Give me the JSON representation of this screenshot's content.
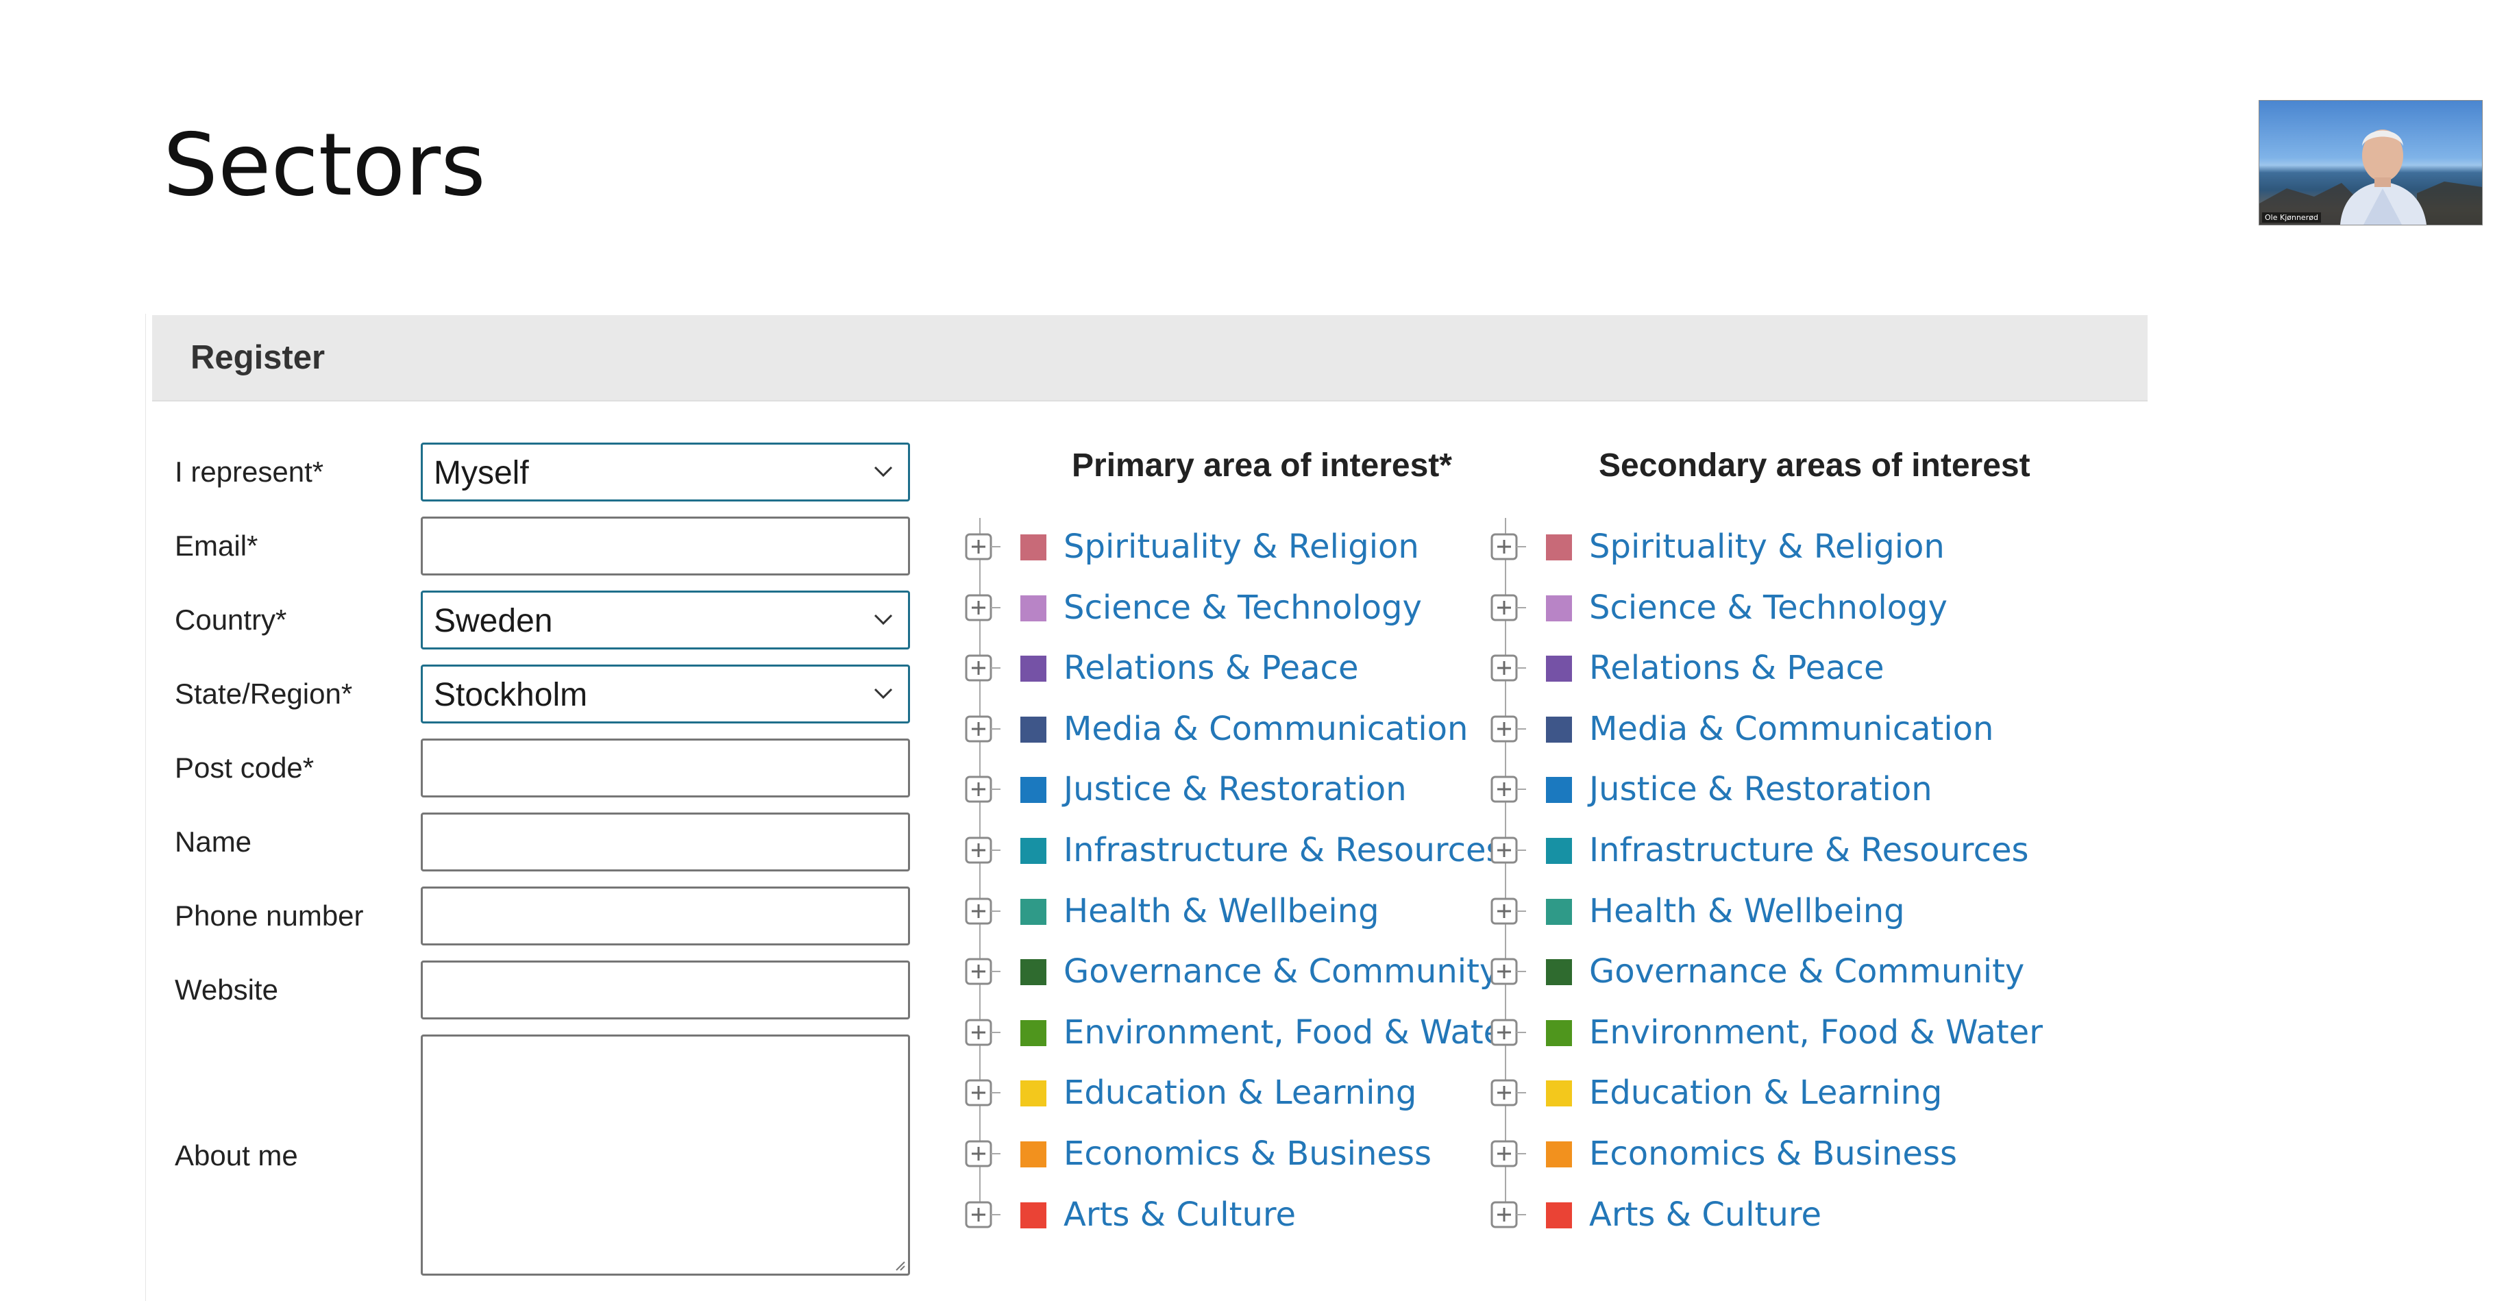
{
  "slide": {
    "title": "Sectors"
  },
  "webcam": {
    "name": "Ole Kjønnerød"
  },
  "form": {
    "header": "Register",
    "fields": [
      {
        "label": "I represent*",
        "type": "select",
        "value": "Myself"
      },
      {
        "label": "Email*",
        "type": "text",
        "value": ""
      },
      {
        "label": "Country*",
        "type": "select",
        "value": "Sweden"
      },
      {
        "label": "State/Region*",
        "type": "select",
        "value": "Stockholm"
      },
      {
        "label": "Post code*",
        "type": "text",
        "value": ""
      },
      {
        "label": "Name",
        "type": "text",
        "value": ""
      },
      {
        "label": "Phone number",
        "type": "text",
        "value": ""
      },
      {
        "label": "Website",
        "type": "text",
        "value": ""
      },
      {
        "label": "About me",
        "type": "textarea",
        "value": ""
      }
    ]
  },
  "primary": {
    "heading": "Primary area of interest*"
  },
  "secondary": {
    "heading": "Secondary areas of interest"
  },
  "sectors": [
    {
      "label": "Spirituality & Religion",
      "color": "#c86a78"
    },
    {
      "label": "Science & Technology",
      "color": "#b884c6"
    },
    {
      "label": "Relations & Peace",
      "color": "#7552a6"
    },
    {
      "label": "Media & Communication",
      "color": "#3e5689"
    },
    {
      "label": "Justice & Restoration",
      "color": "#1b79bf"
    },
    {
      "label": "Infrastructure & Resources",
      "color": "#1791a4"
    },
    {
      "label": "Health & Wellbeing",
      "color": "#2f9a88"
    },
    {
      "label": "Governance & Community",
      "color": "#2f6b2f"
    },
    {
      "label": "Environment, Food & Water",
      "color": "#4f961d"
    },
    {
      "label": "Education & Learning",
      "color": "#f3c81c"
    },
    {
      "label": "Economics & Business",
      "color": "#f2911e"
    },
    {
      "label": "Arts & Culture",
      "color": "#ea4335"
    }
  ],
  "icons": {
    "expand": "expand-plus-icon",
    "dropdown": "chevron-down-icon",
    "resize": "resize-grip-icon"
  },
  "theme": {
    "select_border": "#1f6f8b",
    "link_text": "#2377b8",
    "header_bg": "#e9e9e9"
  }
}
